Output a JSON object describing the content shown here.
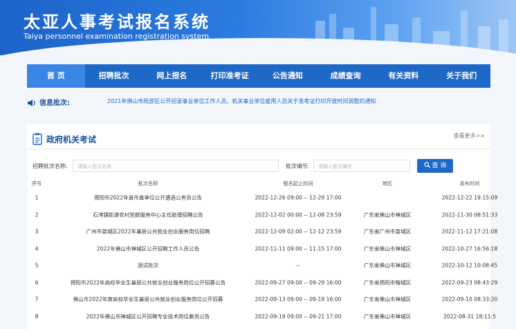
{
  "header": {
    "title_cn": "太亚人事考试报名系统",
    "title_en": "Taiya personnel examination registration system"
  },
  "nav": [
    "首 页",
    "招聘批次",
    "网上报名",
    "打印准考证",
    "公告通知",
    "成绩查询",
    "有关资料",
    "关于我们"
  ],
  "notice": {
    "label": "信息批次:",
    "text": "2021年佛山市局部区公开招录事业单位工作人员、机关事业单位雇用人员关于准考证打印开放时间调整的通知"
  },
  "panel": {
    "title": "政府机关考试",
    "more": "查看更多>>"
  },
  "search": {
    "batch_name_label": "招聘批次名称:",
    "batch_name_placeholder": "请输入批次名称",
    "batch_no_label": "批次编号:",
    "batch_no_placeholder": "请输入批次编号",
    "button": "查 询"
  },
  "table": {
    "headers": [
      "序号",
      "批次名称",
      "报名起止时间",
      "地区",
      "发布时间"
    ],
    "rows": [
      {
        "no": "1",
        "name": "揭阳市2022年县市直单位公开遴选公务员公告",
        "period": "2022-12-26 09:00 -- 12-29 17:00",
        "region": "",
        "published": "2022-12-22 19:15:09"
      },
      {
        "no": "2",
        "name": "石湾镇街道农村党群服务中心主任助理招聘公告",
        "period": "2022-12-02 00:00 -- 12-08 23:59",
        "region": "广东省佛山市禅城区",
        "published": "2022-11-30 08:51:33"
      },
      {
        "no": "3",
        "name": "广州市首城区2022年基层公共就业创业服务岗位招聘",
        "period": "2022-12-09 02:00 -- 12-12 23:59",
        "region": "广东省广州市首城区",
        "published": "2022-11-12 17:21:08"
      },
      {
        "no": "4",
        "name": "2022年佛山市禅城区公开招聘工作人员公告",
        "period": "2022-11-11 09:00 -- 11-15 17:00",
        "region": "广东省佛山市禅城区",
        "published": "2022-10-27 16:56:18"
      },
      {
        "no": "5",
        "name": "测试批次",
        "period": "--",
        "region": "广东省佛山市禅城区",
        "published": "2022-10-12 10:08:45"
      },
      {
        "no": "6",
        "name": "揭阳市2022年高校毕业生基层公共就业创业服务岗位公开招募公告",
        "period": "2022-09-27 09:00 -- 09-29 16:00",
        "region": "广东省揭阳市榕城区",
        "published": "2022-09-23 08:43:29"
      },
      {
        "no": "7",
        "name": "佛山市2022年度高校毕业生基层公共就业创业服务岗位公开招募",
        "period": "2022-09-13 09:00 -- 09-19 16:00",
        "region": "广东省佛山市禅城区",
        "published": "2022-09-10 08:33:20"
      },
      {
        "no": "8",
        "name": "2022年佛山市禅城区公开招聘专业技术岗位雇员公告",
        "period": "2022-09-19 09:00 -- 09-21 17:00",
        "region": "广东省佛山市禅城区",
        "published": "2022-08-31 18:11:5"
      }
    ]
  }
}
